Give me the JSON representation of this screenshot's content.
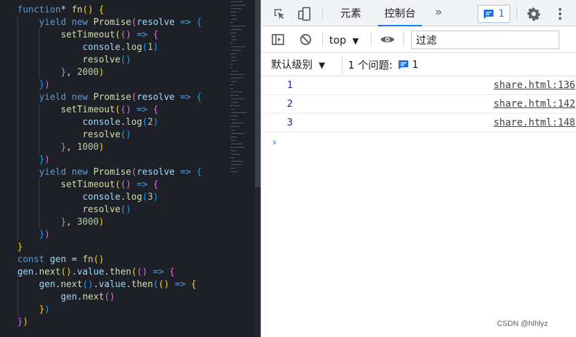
{
  "colors": {
    "editor_bg": "#1e2027",
    "keyword": "#569cd6",
    "function": "#dcdcaa",
    "variable": "#9cdcfe",
    "number": "#b5cea8",
    "bracket_1": "#ffd700",
    "bracket_2": "#da70d6",
    "bracket_3": "#179fff",
    "devtools_accent": "#1a73e8",
    "log_value": "#1f1f9f"
  },
  "editor": {
    "code_lines": [
      [
        [
          "kw",
          "function"
        ],
        [
          "op",
          "* "
        ],
        [
          "fn",
          "fn"
        ],
        [
          "p1",
          "()"
        ],
        [
          "op",
          " "
        ],
        [
          "p1",
          "{"
        ]
      ],
      [
        [
          "op",
          "    "
        ],
        [
          "kw",
          "yield"
        ],
        [
          "op",
          " "
        ],
        [
          "kw",
          "new"
        ],
        [
          "op",
          " "
        ],
        [
          "fn",
          "Promise"
        ],
        [
          "p2",
          "("
        ],
        [
          "var",
          "resolve"
        ],
        [
          "op",
          " "
        ],
        [
          "kw",
          "=>"
        ],
        [
          "op",
          " "
        ],
        [
          "p3",
          "{"
        ]
      ],
      [
        [
          "op",
          "        "
        ],
        [
          "fn",
          "setTimeout"
        ],
        [
          "p1",
          "("
        ],
        [
          "p2",
          "()"
        ],
        [
          "op",
          " "
        ],
        [
          "kw",
          "=>"
        ],
        [
          "op",
          " "
        ],
        [
          "p2",
          "{"
        ]
      ],
      [
        [
          "op",
          "            "
        ],
        [
          "var",
          "console"
        ],
        [
          "op",
          "."
        ],
        [
          "fn",
          "log"
        ],
        [
          "p3",
          "("
        ],
        [
          "num",
          "1"
        ],
        [
          "p3",
          ")"
        ]
      ],
      [
        [
          "op",
          "            "
        ],
        [
          "fn",
          "resolve"
        ],
        [
          "p3",
          "()"
        ]
      ],
      [
        [
          "op",
          "        "
        ],
        [
          "p2",
          "}"
        ],
        [
          "op",
          ", "
        ],
        [
          "num",
          "2000"
        ],
        [
          "p1",
          ")"
        ]
      ],
      [
        [
          "op",
          "    "
        ],
        [
          "p3",
          "}"
        ],
        [
          "p2",
          ")"
        ]
      ],
      [
        [
          "op",
          "    "
        ],
        [
          "kw",
          "yield"
        ],
        [
          "op",
          " "
        ],
        [
          "kw",
          "new"
        ],
        [
          "op",
          " "
        ],
        [
          "fn",
          "Promise"
        ],
        [
          "p2",
          "("
        ],
        [
          "var",
          "resolve"
        ],
        [
          "op",
          " "
        ],
        [
          "kw",
          "=>"
        ],
        [
          "op",
          " "
        ],
        [
          "p3",
          "{"
        ]
      ],
      [
        [
          "op",
          "        "
        ],
        [
          "fn",
          "setTimeout"
        ],
        [
          "p1",
          "("
        ],
        [
          "p2",
          "()"
        ],
        [
          "op",
          " "
        ],
        [
          "kw",
          "=>"
        ],
        [
          "op",
          " "
        ],
        [
          "p2",
          "{"
        ]
      ],
      [
        [
          "op",
          "            "
        ],
        [
          "var",
          "console"
        ],
        [
          "op",
          "."
        ],
        [
          "fn",
          "log"
        ],
        [
          "p3",
          "("
        ],
        [
          "num",
          "2"
        ],
        [
          "p3",
          ")"
        ]
      ],
      [
        [
          "op",
          "            "
        ],
        [
          "fn",
          "resolve"
        ],
        [
          "p3",
          "()"
        ]
      ],
      [
        [
          "op",
          "        "
        ],
        [
          "p2",
          "}"
        ],
        [
          "op",
          ", "
        ],
        [
          "num",
          "1000"
        ],
        [
          "p1",
          ")"
        ]
      ],
      [
        [
          "op",
          "    "
        ],
        [
          "p3",
          "}"
        ],
        [
          "p2",
          ")"
        ]
      ],
      [
        [
          "op",
          "    "
        ],
        [
          "kw",
          "yield"
        ],
        [
          "op",
          " "
        ],
        [
          "kw",
          "new"
        ],
        [
          "op",
          " "
        ],
        [
          "fn",
          "Promise"
        ],
        [
          "p2",
          "("
        ],
        [
          "var",
          "resolve"
        ],
        [
          "op",
          " "
        ],
        [
          "kw",
          "=>"
        ],
        [
          "op",
          " "
        ],
        [
          "p3",
          "{"
        ]
      ],
      [
        [
          "op",
          "        "
        ],
        [
          "fn",
          "setTimeout"
        ],
        [
          "p1",
          "("
        ],
        [
          "p2",
          "()"
        ],
        [
          "op",
          " "
        ],
        [
          "kw",
          "=>"
        ],
        [
          "op",
          " "
        ],
        [
          "p2",
          "{"
        ]
      ],
      [
        [
          "op",
          "            "
        ],
        [
          "var",
          "console"
        ],
        [
          "op",
          "."
        ],
        [
          "fn",
          "log"
        ],
        [
          "p3",
          "("
        ],
        [
          "num",
          "3"
        ],
        [
          "p3",
          ")"
        ]
      ],
      [
        [
          "op",
          "            "
        ],
        [
          "fn",
          "resolve"
        ],
        [
          "p3",
          "()"
        ]
      ],
      [
        [
          "op",
          "        "
        ],
        [
          "p2",
          "}"
        ],
        [
          "op",
          ", "
        ],
        [
          "num",
          "3000"
        ],
        [
          "p1",
          ")"
        ]
      ],
      [
        [
          "op",
          "    "
        ],
        [
          "p3",
          "}"
        ],
        [
          "p2",
          ")"
        ]
      ],
      [
        [
          "p1",
          "}"
        ]
      ],
      [
        [
          "kw",
          "const"
        ],
        [
          "op",
          " "
        ],
        [
          "var",
          "gen"
        ],
        [
          "op",
          " = "
        ],
        [
          "fn",
          "fn"
        ],
        [
          "p1",
          "()"
        ]
      ],
      [
        [
          "var",
          "gen"
        ],
        [
          "op",
          "."
        ],
        [
          "fn",
          "next"
        ],
        [
          "p1",
          "()"
        ],
        [
          "op",
          "."
        ],
        [
          "var",
          "value"
        ],
        [
          "op",
          "."
        ],
        [
          "fn",
          "then"
        ],
        [
          "p1",
          "("
        ],
        [
          "p2",
          "()"
        ],
        [
          "op",
          " "
        ],
        [
          "kw",
          "=>"
        ],
        [
          "op",
          " "
        ],
        [
          "p2",
          "{"
        ]
      ],
      [
        [
          "op",
          "    "
        ],
        [
          "var",
          "gen"
        ],
        [
          "op",
          "."
        ],
        [
          "fn",
          "next"
        ],
        [
          "p3",
          "()"
        ],
        [
          "op",
          "."
        ],
        [
          "var",
          "value"
        ],
        [
          "op",
          "."
        ],
        [
          "fn",
          "then"
        ],
        [
          "p3",
          "("
        ],
        [
          "p1",
          "()"
        ],
        [
          "op",
          " "
        ],
        [
          "kw",
          "=>"
        ],
        [
          "op",
          " "
        ],
        [
          "p1",
          "{"
        ]
      ],
      [
        [
          "op",
          "        "
        ],
        [
          "var",
          "gen"
        ],
        [
          "op",
          "."
        ],
        [
          "fn",
          "next"
        ],
        [
          "p2",
          "()"
        ]
      ],
      [
        [
          "op",
          "    "
        ],
        [
          "p1",
          "}"
        ],
        [
          "p3",
          ")"
        ]
      ],
      [
        [
          "p2",
          "}"
        ],
        [
          "p1",
          ")"
        ]
      ]
    ]
  },
  "devtools": {
    "tabs": {
      "elements": "元素",
      "console": "控制台",
      "more": "»"
    },
    "message_badge_count": "1",
    "toolbar": {
      "context": "top",
      "context_arrow": "▼",
      "filter_placeholder": "过滤"
    },
    "levelbar": {
      "level": "默认级别",
      "level_arrow": "▼",
      "issues_label": "1 个问题:",
      "issues_count": "1"
    },
    "messages": [
      {
        "text": "1",
        "source": "share.html:136"
      },
      {
        "text": "2",
        "source": "share.html:142"
      },
      {
        "text": "3",
        "source": "share.html:148"
      }
    ],
    "prompt": "›"
  },
  "watermark": "CSDN @hlhlyz",
  "icons": {
    "inspect": "inspect-element-icon",
    "device": "device-toolbar-icon",
    "message": "message-icon",
    "settings": "gear-icon",
    "menu": "kebab-menu-icon",
    "sidebar": "sidebar-toggle-icon",
    "clear": "clear-console-icon",
    "eye": "eye-icon"
  }
}
